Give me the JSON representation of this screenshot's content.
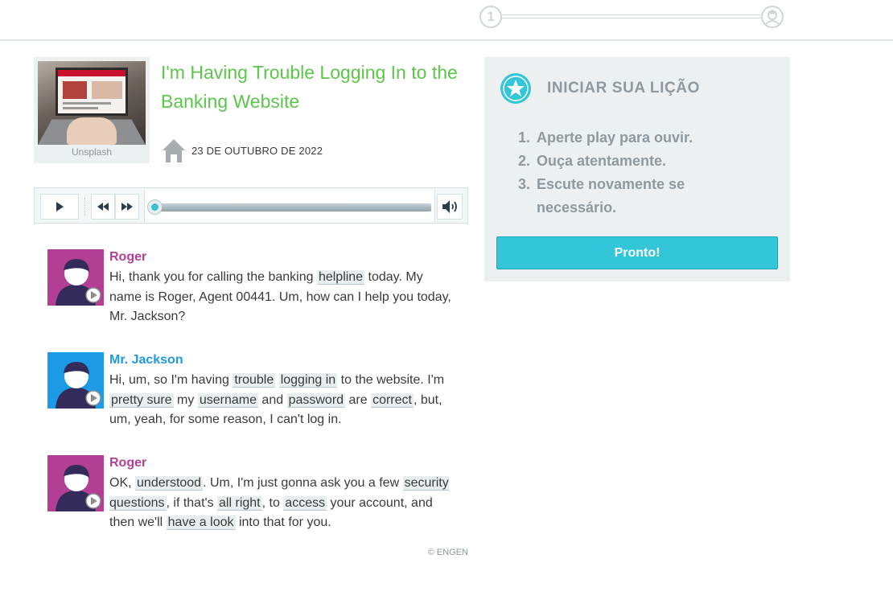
{
  "progress": {
    "step1_label": "1",
    "step2_icon": "graduation-cap-icon"
  },
  "article": {
    "thumbnail_credit": "Unsplash",
    "title": "I'm Having Trouble Logging In to the Banking Website",
    "date": "23 DE OUTUBRO DE 2022",
    "date_icon": "home-icon"
  },
  "player": {
    "icons": [
      "play-icon",
      "rewind-icon",
      "fast-forward-icon",
      "volume-icon"
    ],
    "position_fraction": 0.0
  },
  "dialogue": [
    {
      "speaker": "Roger",
      "segments": [
        {
          "text": "Hi, thank you for calling the banking "
        },
        {
          "text": "helpline",
          "vocab": true
        },
        {
          "text": " today. My name is Roger, Agent 00441. Um, how can I help you today, Mr. Jackson?"
        }
      ]
    },
    {
      "speaker": "Mr. Jackson",
      "segments": [
        {
          "text": "Hi, um, so I'm having "
        },
        {
          "text": "trouble",
          "vocab": true
        },
        {
          "text": " "
        },
        {
          "text": "logging in",
          "vocab": true
        },
        {
          "text": " to the website. I'm "
        },
        {
          "text": "pretty sure",
          "vocab": true
        },
        {
          "text": " my "
        },
        {
          "text": "username",
          "vocab": true
        },
        {
          "text": " and "
        },
        {
          "text": "password",
          "vocab": true
        },
        {
          "text": " are "
        },
        {
          "text": "correct",
          "vocab": true
        },
        {
          "text": ", but, um, yeah, for some reason, I can't log in."
        }
      ]
    },
    {
      "speaker": "Roger",
      "segments": [
        {
          "text": "OK, "
        },
        {
          "text": "understood",
          "vocab": true
        },
        {
          "text": ". Um, I'm just gonna ask you a few "
        },
        {
          "text": "security questions",
          "vocab": true
        },
        {
          "text": ", if that's "
        },
        {
          "text": "all right",
          "vocab": true
        },
        {
          "text": ", to "
        },
        {
          "text": "access",
          "vocab": true
        },
        {
          "text": " your account, and then we'll "
        },
        {
          "text": "have a look",
          "vocab": true
        },
        {
          "text": " into that for you."
        }
      ]
    }
  ],
  "copyright": "© ENGEN",
  "lesson": {
    "title": "INICIAR SUA LIÇÃO",
    "steps": [
      {
        "num": "1.",
        "text": "Aperte play para ouvir."
      },
      {
        "num": "2.",
        "text": "Ouça atentamente."
      },
      {
        "num": "3.",
        "text": "Escute novamente se necessário."
      }
    ],
    "button_label": "Pronto!"
  },
  "colors": {
    "title_green": "#5cc64a",
    "speaker_pink": "#b33f95",
    "speaker_blue": "#1d9ae6",
    "button_teal": "#33c6d9",
    "panel_gray": "#edf0f1"
  }
}
